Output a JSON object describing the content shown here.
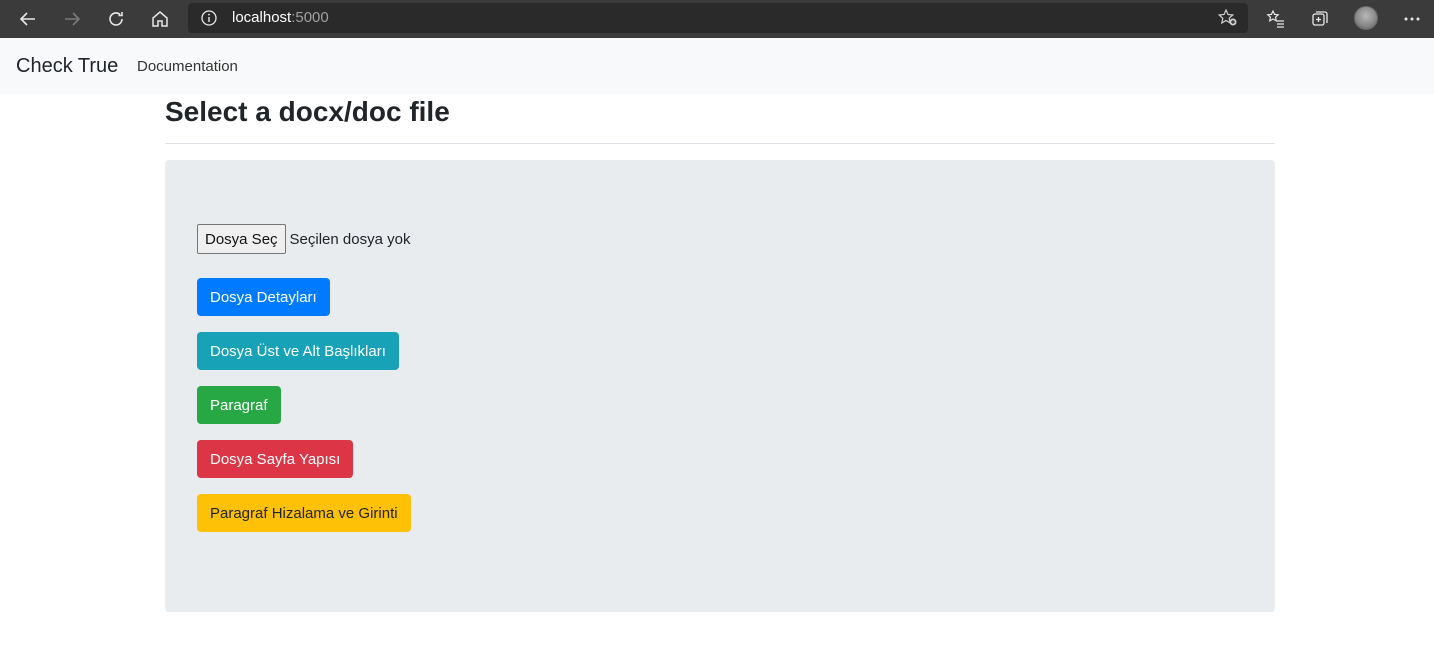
{
  "browser": {
    "url_host": "localhost",
    "url_port": ":5000",
    "icons": {
      "back": "back-arrow-icon",
      "forward": "forward-arrow-icon",
      "refresh": "refresh-icon",
      "home": "home-icon",
      "info": "info-icon",
      "add_favorite": "star-add-icon",
      "favorites": "favorites-list-icon",
      "collections": "collections-icon",
      "profile": "profile-avatar",
      "more": "more-dots-icon"
    }
  },
  "navbar": {
    "brand": "Check True",
    "links": [
      "Documentation"
    ]
  },
  "main": {
    "title": "Select a docx/doc file",
    "file_input": {
      "button_label": "Dosya Seç",
      "status": "Seçilen dosya yok"
    },
    "buttons": [
      {
        "label": "Dosya Detayları",
        "style": "primary",
        "color": "#007bff"
      },
      {
        "label": "Dosya Üst ve Alt Başlıkları",
        "style": "info",
        "color": "#17a2b8"
      },
      {
        "label": "Paragraf",
        "style": "success",
        "color": "#28a745"
      },
      {
        "label": "Dosya Sayfa Yapısı",
        "style": "danger",
        "color": "#dc3545"
      },
      {
        "label": "Paragraf Hizalama ve Girinti",
        "style": "warning",
        "color": "#ffc107"
      }
    ]
  },
  "colors": {
    "browser_chrome": "#3b3b3b",
    "navbar_bg": "#f8f9fa",
    "jumbotron_bg": "#e9ecef"
  }
}
